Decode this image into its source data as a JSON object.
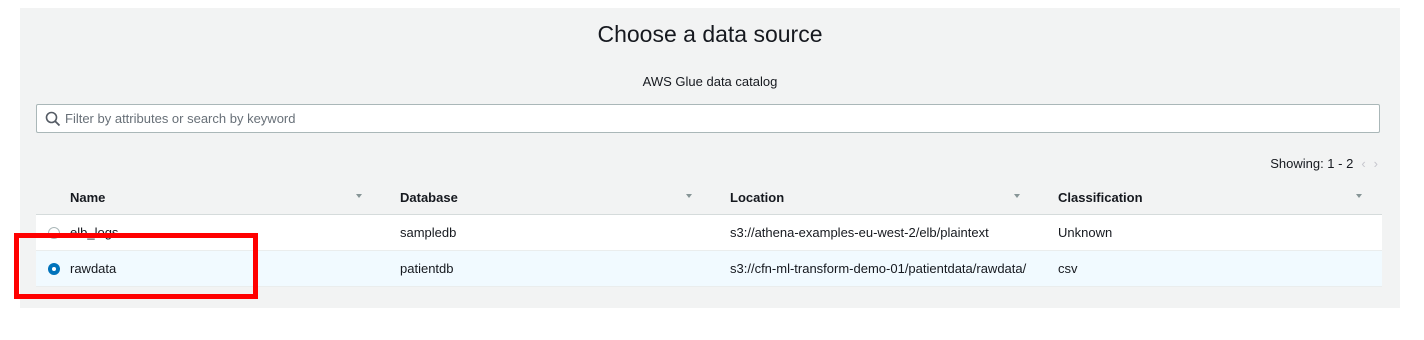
{
  "dialog": {
    "title": "Choose a data source",
    "subtitle": "AWS Glue data catalog"
  },
  "search": {
    "placeholder": "Filter by attributes or search by keyword",
    "value": ""
  },
  "pager": {
    "showing": "Showing: 1 - 2",
    "prev": "‹",
    "next": "›"
  },
  "table": {
    "columns": [
      "Name",
      "Database",
      "Location",
      "Classification"
    ],
    "rows": [
      {
        "name": "elb_logs",
        "database": "sampledb",
        "location": "s3://athena-examples-eu-west-2/elb/plaintext",
        "classification": "Unknown",
        "selected": false
      },
      {
        "name": "rawdata",
        "database": "patientdb",
        "location": "s3://cfn-ml-transform-demo-01/patientdata/rawdata/",
        "classification": "csv",
        "selected": true
      }
    ]
  },
  "colors": {
    "accent": "#0073bb",
    "highlight_box": "#ff0000",
    "selected_row": "#f1faff"
  }
}
